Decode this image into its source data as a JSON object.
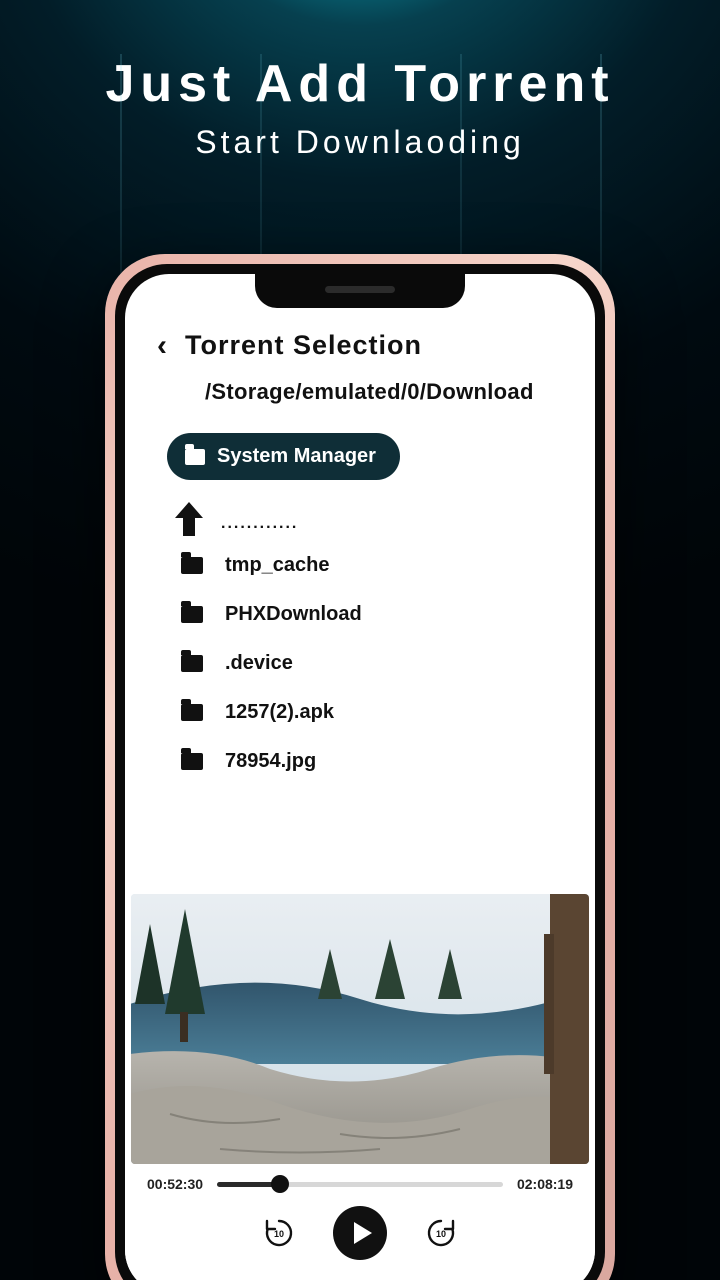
{
  "promo": {
    "headline": "Just Add Torrent",
    "subhead": "Start Downlaoding"
  },
  "app": {
    "title": "Torrent Selection",
    "path": "/Storage/emulated/0/Download",
    "chip_label": "System Manager",
    "up_label": "............",
    "items": [
      {
        "label": "tmp_cache"
      },
      {
        "label": "PHXDownload"
      },
      {
        "label": ".device"
      },
      {
        "label": "1257(2).apk"
      },
      {
        "label": "78954.jpg"
      }
    ]
  },
  "player": {
    "elapsed": "00:52:30",
    "total": "02:08:19",
    "progress_pct": 22,
    "skip_seconds": "10"
  }
}
